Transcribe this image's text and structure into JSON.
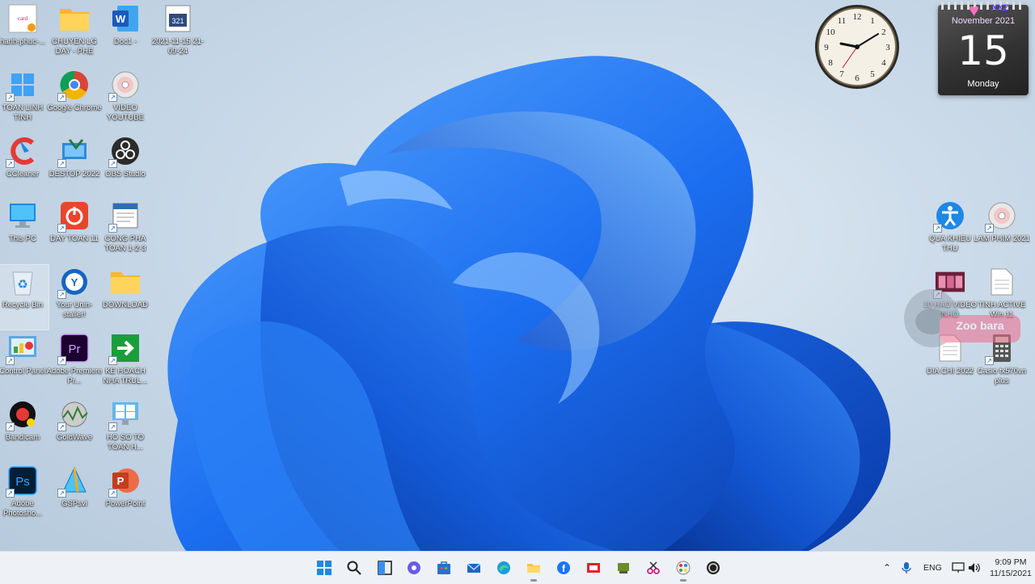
{
  "desktop_icons_left": [
    {
      "label": "hanh-phuc-...",
      "icon": "image-file-icon"
    },
    {
      "label": "CHUYEN  LG DAY - PHE",
      "icon": "folder-icon"
    },
    {
      "label": "Doc1 -",
      "icon": "word-icon"
    },
    {
      "label": "2021-11-15 21-09-24",
      "icon": "video-file-icon"
    },
    {
      "label": "TOAN LINH TINH",
      "icon": "windows-folder-icon"
    },
    {
      "label": "Google Chrome",
      "icon": "chrome-icon"
    },
    {
      "label": "VIDEO YOUTUBE",
      "icon": "disc-icon"
    },
    {
      "label": "CCleaner",
      "icon": "ccleaner-icon"
    },
    {
      "label": "DESTOP 2022",
      "icon": "desktop-shortcut-icon"
    },
    {
      "label": "OBS Studio",
      "icon": "obs-icon"
    },
    {
      "label": "This PC",
      "icon": "monitor-icon"
    },
    {
      "label": "DAY TOAN 11",
      "icon": "power-app-icon"
    },
    {
      "label": "CONG PHA TOAN 1-2-3",
      "icon": "document-icon"
    },
    {
      "label": "Recycle Bin",
      "icon": "recycle-bin-icon"
    },
    {
      "label": "Your Unin-staller!",
      "icon": "uninstaller-icon"
    },
    {
      "label": "DOWNLOAD",
      "icon": "folder-icon"
    },
    {
      "label": "Control Panel",
      "icon": "control-panel-icon"
    },
    {
      "label": "Adobe Premiere Pr...",
      "icon": "premiere-icon"
    },
    {
      "label": "KE HOACH NHA TRUL...",
      "icon": "arrow-shortcut-icon"
    },
    {
      "label": "Bandicam",
      "icon": "bandicam-icon"
    },
    {
      "label": "GoldWave",
      "icon": "goldwave-icon"
    },
    {
      "label": "HO SO TO TOAN H...",
      "icon": "monitor-grid-icon"
    },
    {
      "label": "Adobe Photosho...",
      "icon": "photoshop-icon"
    },
    {
      "label": "GSPsvi",
      "icon": "gsp-icon"
    },
    {
      "label": "PowerPoint",
      "icon": "powerpoint-icon"
    }
  ],
  "desktop_icons_right": [
    {
      "label": "QUA KHIEU THU",
      "icon": "accessibility-icon"
    },
    {
      "label": "LAM PHIM 2021",
      "icon": "disc-icon"
    },
    {
      "label": "10 HAO VIDEO NHO",
      "icon": "film-icon"
    },
    {
      "label": "TINH ACTIVE Win 11",
      "icon": "text-file-icon"
    },
    {
      "label": "DIA CHI 2022",
      "icon": "text-file-icon"
    },
    {
      "label": "Casio fx570vn plus",
      "icon": "calculator-icon"
    }
  ],
  "calendar": {
    "month": "November 2021",
    "day": "15",
    "weekday": "Monday",
    "brand": "XXZ"
  },
  "clock": {
    "hours": [
      12,
      1,
      2,
      3,
      4,
      5,
      6,
      7,
      8,
      9,
      10,
      11
    ],
    "time": "9:09"
  },
  "watermark": {
    "text": "Zoo bara"
  },
  "taskbar": {
    "apps": [
      "start-icon",
      "search-icon",
      "task-view-icon",
      "chat-icon",
      "store-icon",
      "mail-icon",
      "edge-icon",
      "file-explorer-icon",
      "facebook-icon",
      "app-red-icon",
      "app-desk-icon",
      "snipping-icon",
      "paint-icon",
      "obs-icon"
    ],
    "tray": {
      "lang": "ENG",
      "time": "9:09 PM",
      "date": "11/15/2021"
    }
  },
  "colors": {
    "bloom": "#1a6fe8",
    "bloom_dark": "#0b3fb0",
    "taskbar": "#eef2f6"
  }
}
